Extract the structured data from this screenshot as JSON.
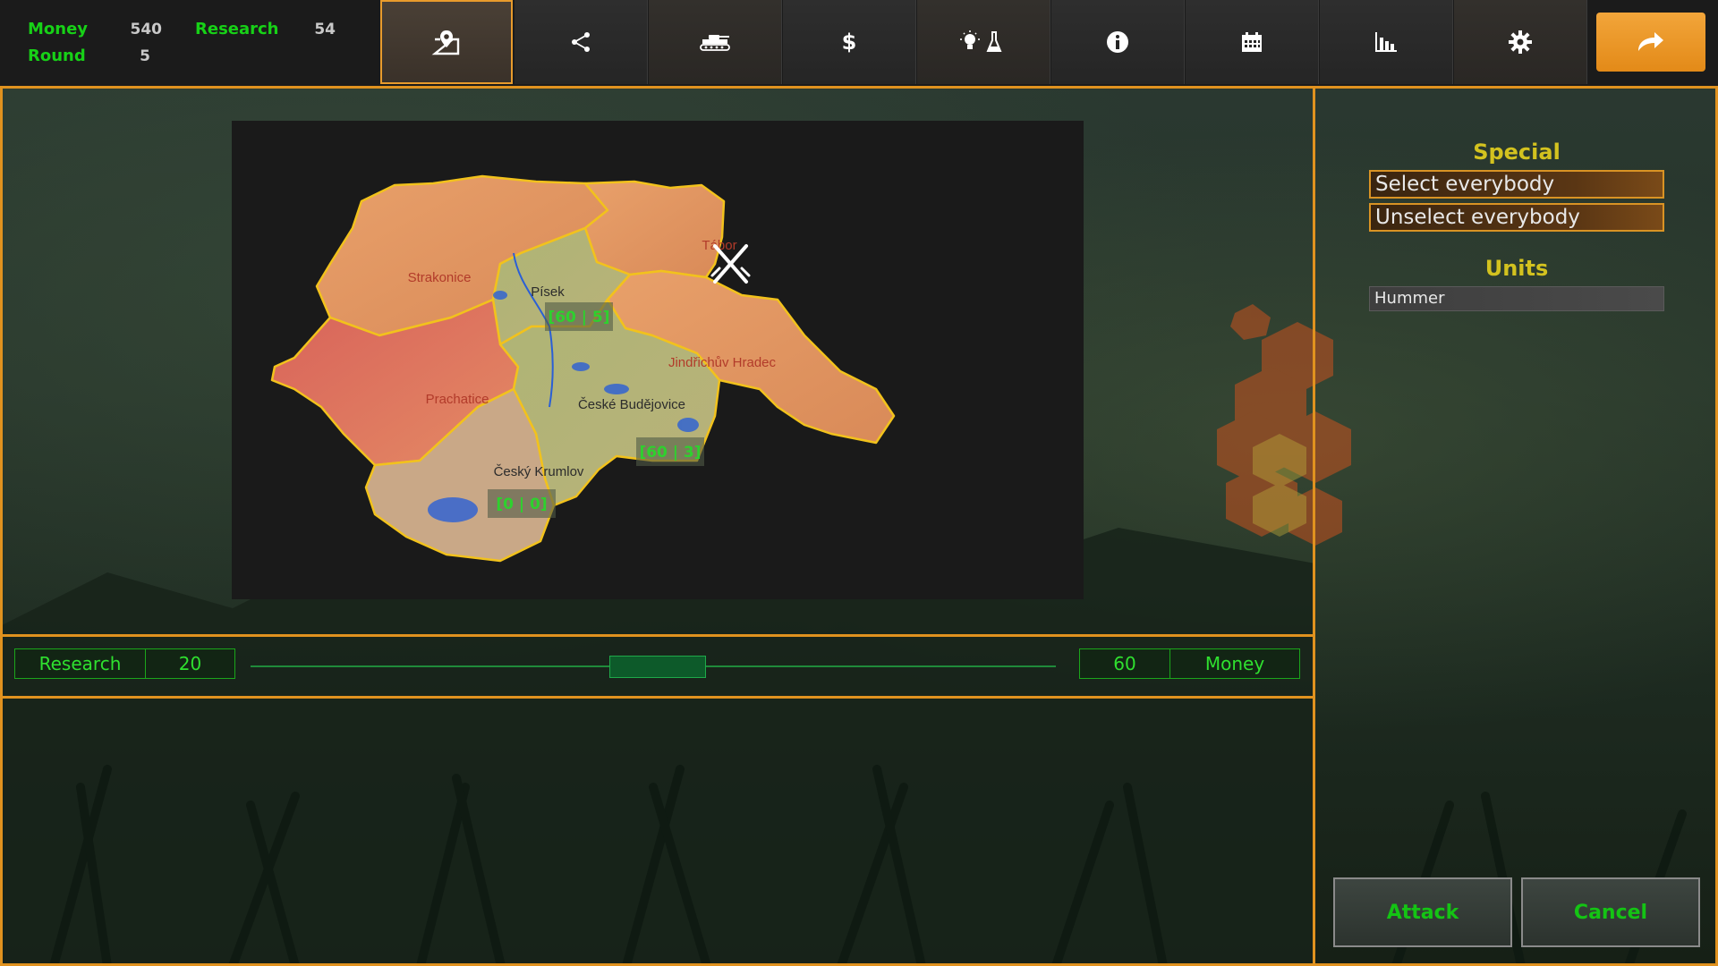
{
  "stats": {
    "money_label": "Money",
    "money_value": "540",
    "research_label": "Research",
    "research_value": "54",
    "round_label": "Round",
    "round_value": "5"
  },
  "tabs": [
    {
      "name": "map-tab",
      "icon": "map-pin-icon"
    },
    {
      "name": "diplomacy-tab",
      "icon": "share-icon"
    },
    {
      "name": "military-tab",
      "icon": "tank-icon"
    },
    {
      "name": "economy-tab",
      "icon": "dollar-icon"
    },
    {
      "name": "research-tab",
      "icon": "lightbulb-flask-icon"
    },
    {
      "name": "info-tab",
      "icon": "info-icon"
    },
    {
      "name": "calendar-tab",
      "icon": "calendar-icon"
    },
    {
      "name": "statistics-tab",
      "icon": "bar-chart-icon"
    },
    {
      "name": "settings-tab",
      "icon": "gear-icon"
    }
  ],
  "end_turn": {
    "icon": "redo-arrow-icon"
  },
  "map": {
    "regions": [
      {
        "name": "Strakonice"
      },
      {
        "name": "Písek",
        "tag": "[60 | 5]"
      },
      {
        "name": "Tábor",
        "icon": "crossed-swords-icon"
      },
      {
        "name": "Jindřichův Hradec"
      },
      {
        "name": "Prachatice"
      },
      {
        "name": "České Budějovice",
        "tag": "[60 | 3]"
      },
      {
        "name": "Český Krumlov",
        "tag": "[0 | 0]"
      }
    ]
  },
  "split": {
    "left_label": "Research",
    "left_value": "20",
    "right_value": "60",
    "right_label": "Money"
  },
  "special": {
    "title": "Special",
    "select_all": "Select everybody",
    "unselect_all": "Unselect everybody"
  },
  "units": {
    "title": "Units",
    "items": [
      "Hummer"
    ]
  },
  "actions": {
    "attack": "Attack",
    "cancel": "Cancel"
  },
  "colors": {
    "accent": "#e0921f",
    "green": "#17d117",
    "title_yellow": "#d3c21f"
  }
}
